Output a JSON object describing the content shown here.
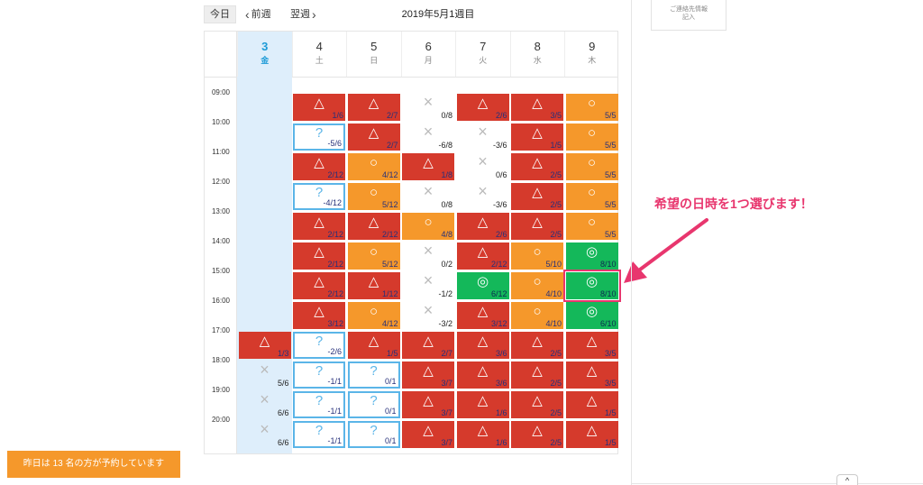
{
  "toolbar": {
    "today": "今日",
    "prev": "前週",
    "next": "翌週",
    "title": "2019年5月1週目"
  },
  "days": [
    {
      "num": "3",
      "wd": "金",
      "today": true
    },
    {
      "num": "4",
      "wd": "土"
    },
    {
      "num": "5",
      "wd": "日"
    },
    {
      "num": "6",
      "wd": "月"
    },
    {
      "num": "7",
      "wd": "火"
    },
    {
      "num": "8",
      "wd": "水"
    },
    {
      "num": "9",
      "wd": "木"
    }
  ],
  "times": [
    "09:00",
    "10:00",
    "11:00",
    "12:00",
    "13:00",
    "14:00",
    "15:00",
    "16:00",
    "17:00",
    "18:00",
    "19:00",
    "20:00"
  ],
  "status_symbols": {
    "red": "△",
    "orange": "○",
    "green": "◎",
    "full": "×",
    "q": "?"
  },
  "colors": {
    "red": "#d53a2c",
    "orange": "#f5982b",
    "green": "#14b85a",
    "question_border": "#5bb5e8",
    "today": "#1e9bd7",
    "accent": "#e8366e"
  },
  "slots": [
    [
      null,
      [
        "red",
        "1/6"
      ],
      [
        "red",
        "2/7"
      ],
      [
        "full",
        "0/8"
      ],
      [
        "red",
        "2/6"
      ],
      [
        "red",
        "3/5"
      ],
      [
        "orange",
        "5/5"
      ]
    ],
    [
      null,
      [
        "q",
        "-5/6"
      ],
      [
        "red",
        "2/7"
      ],
      [
        "full",
        "-6/8"
      ],
      [
        "full",
        "-3/6"
      ],
      [
        "red",
        "1/5"
      ],
      [
        "orange",
        "5/5"
      ]
    ],
    [
      null,
      [
        "red",
        "2/12"
      ],
      [
        "orange",
        "4/12"
      ],
      [
        "red",
        "1/8"
      ],
      [
        "full",
        "0/6"
      ],
      [
        "red",
        "2/5"
      ],
      [
        "orange",
        "5/5"
      ]
    ],
    [
      null,
      [
        "q",
        "-4/12"
      ],
      [
        "orange",
        "5/12"
      ],
      [
        "full",
        "0/8"
      ],
      [
        "full",
        "-3/6"
      ],
      [
        "red",
        "2/5"
      ],
      [
        "orange",
        "5/5"
      ]
    ],
    [
      null,
      [
        "red",
        "2/12"
      ],
      [
        "red",
        "2/12"
      ],
      [
        "orange",
        "4/8"
      ],
      [
        "red",
        "2/6"
      ],
      [
        "red",
        "2/5"
      ],
      [
        "orange",
        "5/5"
      ]
    ],
    [
      null,
      [
        "red",
        "2/12"
      ],
      [
        "orange",
        "5/12"
      ],
      [
        "full",
        "0/2"
      ],
      [
        "red",
        "2/12"
      ],
      [
        "orange",
        "5/10"
      ],
      [
        "green",
        "8/10"
      ]
    ],
    [
      null,
      [
        "red",
        "2/12"
      ],
      [
        "red",
        "1/12"
      ],
      [
        "full",
        "-1/2"
      ],
      [
        "green",
        "6/12"
      ],
      [
        "orange",
        "4/10"
      ],
      [
        "green",
        "8/10",
        "hl"
      ]
    ],
    [
      null,
      [
        "red",
        "3/12"
      ],
      [
        "orange",
        "4/12"
      ],
      [
        "full",
        "-3/2"
      ],
      [
        "red",
        "3/12"
      ],
      [
        "orange",
        "4/10"
      ],
      [
        "green",
        "6/10"
      ]
    ],
    [
      [
        "red",
        "1/3"
      ],
      [
        "q",
        "-2/6"
      ],
      [
        "red",
        "1/5"
      ],
      [
        "red",
        "2/7"
      ],
      [
        "red",
        "3/6"
      ],
      [
        "red",
        "2/5"
      ],
      [
        "red",
        "3/5"
      ]
    ],
    [
      [
        "full",
        "5/6"
      ],
      [
        "q",
        "-1/1"
      ],
      [
        "q",
        "0/1"
      ],
      [
        "red",
        "3/7"
      ],
      [
        "red",
        "3/6"
      ],
      [
        "red",
        "2/5"
      ],
      [
        "red",
        "3/5"
      ]
    ],
    [
      [
        "full",
        "6/6"
      ],
      [
        "q",
        "-1/1"
      ],
      [
        "q",
        "0/1"
      ],
      [
        "red",
        "3/7"
      ],
      [
        "red",
        "1/6"
      ],
      [
        "red",
        "2/5"
      ],
      [
        "red",
        "1/5"
      ]
    ],
    [
      [
        "full",
        "6/6"
      ],
      [
        "q",
        "-1/1"
      ],
      [
        "q",
        "0/1"
      ],
      [
        "red",
        "3/7"
      ],
      [
        "red",
        "1/6"
      ],
      [
        "red",
        "2/5"
      ],
      [
        "red",
        "1/5"
      ]
    ]
  ],
  "annotation": "希望の日時を1つ選びます！",
  "contact": {
    "line1": "ご連絡先情報",
    "line2": "記入"
  },
  "footer_banner": "昨日は 13 名の方が予約しています",
  "scroll_top_icon": "chevron-up-icon"
}
